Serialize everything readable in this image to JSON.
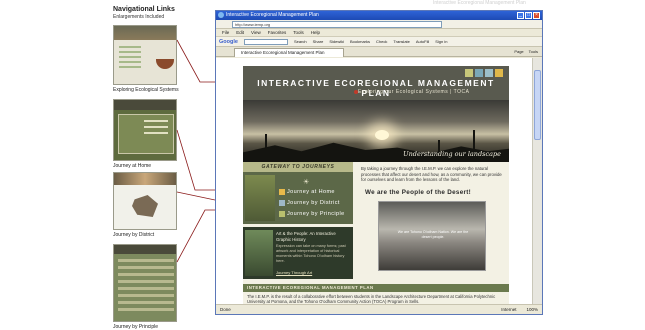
{
  "nav": {
    "title": "Navigational Links",
    "subtitle": "Enlargements Included",
    "captions": [
      "Exploring Ecological Systems",
      "Journey at Home",
      "Journey by District",
      "Journey by Principle"
    ]
  },
  "browser": {
    "window_title": "Interactive Ecoregional Management Plan",
    "watermark": "Interactive Ecoregional Management Plan",
    "address": "http://www.iemp.org",
    "menu": [
      "File",
      "Edit",
      "View",
      "Favorites",
      "Tools",
      "Help"
    ],
    "google_label": "Google",
    "google_buttons": [
      "Search",
      "Share",
      "Sidewiki",
      "Bookmarks",
      "Check",
      "Translate",
      "AutoFill",
      "Sign in"
    ],
    "tab_label": "Interactive Ecoregional Management Plan",
    "tab_tools": [
      "Page",
      "Tools"
    ],
    "status_left": "Done",
    "status_zone": "Internet",
    "status_zoom": "100%"
  },
  "page": {
    "title": "INTERACTIVE ECOREGIONAL MANAGEMENT PLAN",
    "subtitle": "Exploring our Ecological Systems | TOCA",
    "hero_caption": "Understanding our landscape",
    "gateway": "GATEWAY TO JOURNEYS",
    "journeys": [
      "Journey at Home",
      "Journey by District",
      "Journey by Principle"
    ],
    "art_title": "Art & the People: An Interactive Graphic History",
    "art_text": "Expression can take on many forms; past artwork and interpretation of historical moments within Tohono O'odham history here.",
    "art_link": "Journey Through Art",
    "intro": "By taking a journey through the I.E.M.P. we can explore the natural processes that affect our desert and how, as a community, we can provide for ourselves and learn from the lessons of the land.",
    "people_heading": "We are the People of the Desert!",
    "people_caption": "We are Tohono O'odham Nation. We are the desert people.",
    "footer_heading": "INTERACTIVE ECOREGIONAL MANAGEMENT PLAN",
    "footer_text": "The I.E.M.P. is the result of a collaborative effort between students in the Landscape Architecture Department at California Polytechnic University at Pomona, and the Tohono O'odham Community Action (TOCA) Program in Sells."
  },
  "colors": {
    "swatch_1": "#c7c77a",
    "swatch_2": "#7aa8b8",
    "swatch_3": "#9cbfc9",
    "swatch_4": "#e0b84a",
    "connector": "#8a1a1a"
  }
}
